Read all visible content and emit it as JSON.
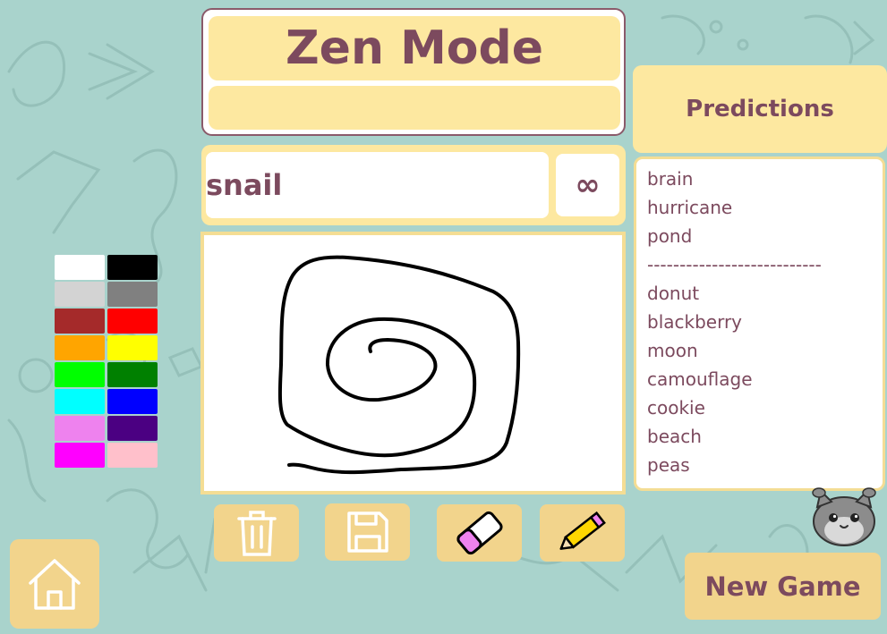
{
  "header": {
    "title": "Zen Mode",
    "subtitle": ""
  },
  "word_row": {
    "word": "snail",
    "timer": "∞"
  },
  "palette": {
    "colors": [
      "#ffffff",
      "#000000",
      "#d3d3d3",
      "#808080",
      "#a52a2a",
      "#ff0000",
      "#ffa500",
      "#ffff00",
      "#00ff00",
      "#008000",
      "#00ffff",
      "#0000ff",
      "#ee82ee",
      "#4b0082",
      "#ff00ff",
      "#ffc0cb"
    ]
  },
  "predictions": {
    "title": "Predictions",
    "top_items": [
      "brain",
      "hurricane",
      "pond"
    ],
    "separator": "---------------------------",
    "other_items": [
      "donut",
      "blackberry",
      "moon",
      "camouflage",
      "cookie",
      "beach",
      "peas"
    ]
  },
  "toolbar": {
    "clear_icon": "trash-icon",
    "save_icon": "floppy-disk-icon",
    "eraser_icon": "eraser-icon",
    "pencil_icon": "pencil-icon"
  },
  "footer": {
    "home_icon": "home-icon",
    "new_game_label": "New Game"
  }
}
